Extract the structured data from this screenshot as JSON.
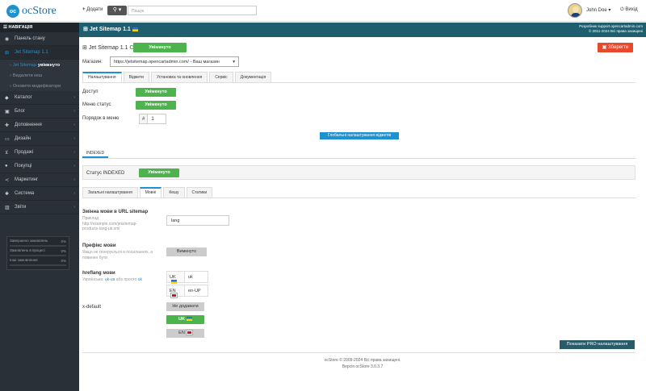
{
  "brand": {
    "logo_text": "ocStore",
    "logo_mark": "oc"
  },
  "topbar": {
    "add_label": "Додати",
    "search_placeholder": "Пошук",
    "user_name": "John Doe",
    "logout_label": "Вихід"
  },
  "sidebar": {
    "header": "НАВІГАЦІЯ",
    "items": [
      {
        "label": "Панель стану",
        "icon": "dashboard-icon"
      },
      {
        "label": "Jet Sitemap 1.1",
        "icon": "sitemap-icon"
      },
      {
        "label": "Каталог",
        "icon": "tag-icon"
      },
      {
        "label": "Блог",
        "icon": "blog-icon"
      },
      {
        "label": "Доповнення",
        "icon": "puzzle-icon"
      },
      {
        "label": "Дизайн",
        "icon": "monitor-icon"
      },
      {
        "label": "Продажі",
        "icon": "cart-icon"
      },
      {
        "label": "Покупці",
        "icon": "user-icon"
      },
      {
        "label": "Маркетинг",
        "icon": "share-icon"
      },
      {
        "label": "Система",
        "icon": "gear-icon"
      },
      {
        "label": "Звіти",
        "icon": "chart-icon"
      }
    ],
    "subitems": [
      {
        "label": "Jet Sitemap",
        "state": "увімкнуто"
      },
      {
        "label": "Видалити кеш"
      },
      {
        "label": "Оновити модифікатори"
      }
    ],
    "progress": [
      {
        "label": "Завершено замовлень",
        "pct": "0%",
        "value": 0
      },
      {
        "label": "Замовлень в процесі",
        "pct": "0%",
        "value": 0
      },
      {
        "label": "Інші замовлення",
        "pct": "0%",
        "value": 0
      }
    ]
  },
  "titlebar": {
    "title": "Jet Sitemap 1.1",
    "dev": "Розробник support.opencartadmin.com",
    "copy": "© 2011-2024 Всі права захищені"
  },
  "header": {
    "title": "Jet Sitemap 1.1",
    "status_label": "Статус",
    "status_value": "Увімкнуто",
    "save_label": "Зберегти"
  },
  "store": {
    "label": "Магазин:",
    "value": "https://jetsitemap.opencartadmin.com/ - Ваш магазин"
  },
  "main_tabs": [
    "Налаштування",
    "Віджети",
    "Установка та оновлення",
    "Сервіс",
    "Документація"
  ],
  "settings": {
    "access_label": "Доступ",
    "access_value": "Увімкнуто",
    "menu_label": "Меню статус",
    "menu_value": "Увімкнуто",
    "order_label": "Порядок в меню",
    "order_prefix": "#",
    "order_value": "1",
    "global_btn": "Глобальні налаштування віджетів"
  },
  "indexed": {
    "tab": "INDEXED",
    "status_label": "Статус INDEXED",
    "status_value": "Увімкнуто",
    "tabs": [
      "Загальні налаштування",
      "Мовні",
      "Кешу",
      "Статики"
    ]
  },
  "lang": {
    "var_label": "Змінна мови в URL sitemap",
    "var_help1": "Приклад",
    "var_help2": "http://example.com/jetsitemap-",
    "var_help3": "products-lang-uk.xml",
    "var_value": "lang",
    "prefix_label": "Префікс мови",
    "prefix_help1": "Якщо не генерується в посиланнях, а",
    "prefix_help2": "повинен бути",
    "prefix_value": "Вимкнуто",
    "hreflang_label": "hreflang мови",
    "hreflang_help_pre": "Українська:",
    "hreflang_help_a": "uk-ua",
    "hreflang_help_mid": "або просто",
    "hreflang_help_b": "uk",
    "hreflang": [
      {
        "code": "UK",
        "value": "uk"
      },
      {
        "code": "EN",
        "value": "en-UP"
      }
    ],
    "xdefault_label": "x-default",
    "xdefault_none": "Не додавати",
    "xdefault_uk": "UK",
    "xdefault_en": "EN"
  },
  "pro_btn": "Показати PRO налаштування",
  "footer": {
    "line1": "ocStore © 2009-2024 Всі права захищені.",
    "line2": "Версія ocStore 3.0.3.7"
  }
}
